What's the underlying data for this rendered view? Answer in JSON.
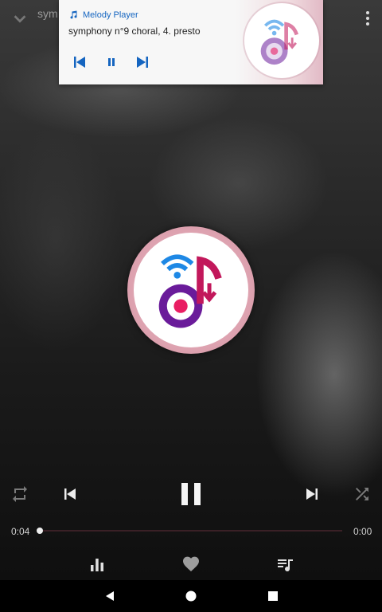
{
  "top": {
    "title": "sym"
  },
  "notification": {
    "app_name": "Melody Player",
    "song": "symphony n°9 choral, 4. presto"
  },
  "player": {
    "elapsed": "0:04",
    "duration": "0:00",
    "progress": 0.0
  },
  "colors": {
    "accent": "#e91e8c",
    "wifi_blue": "#1e88e5",
    "disc_purple": "#6a1b9a",
    "note_magenta": "#c2185b",
    "notif_blue": "#1565c0"
  },
  "icons": [
    "chevron-down-icon",
    "overflow-menu-icon",
    "music-note-icon",
    "skip-previous-icon",
    "pause-icon",
    "skip-next-icon",
    "repeat-icon",
    "shuffle-icon",
    "equalizer-icon",
    "heart-icon",
    "playlist-icon",
    "back-icon",
    "home-icon",
    "recents-icon"
  ]
}
